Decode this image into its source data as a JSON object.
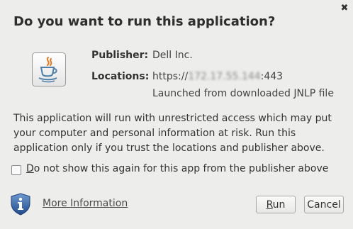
{
  "dialog": {
    "title": "Do you want to run this application?",
    "close_icon": "close-icon",
    "app_icon": "java-cup-icon",
    "publisher_label": "Publisher:",
    "publisher_value": "Dell Inc.",
    "locations_label": "Locations:",
    "location_prefix": "https://",
    "location_redacted": "172.17.55.144",
    "location_suffix": ":443",
    "launched_from": "Launched from downloaded JNLP file",
    "message": "This application will run with unrestricted access which may put your computer and personal information at risk. Run this application only if you trust the locations and publisher above.",
    "checkbox": {
      "checked": false,
      "label_mnemonic": "D",
      "label_rest": "o not show this again for this app from the publisher above"
    },
    "info_icon": "shield-info-icon",
    "more_info_link": "More Information",
    "run_button": {
      "mnemonic": "R",
      "rest": "un"
    },
    "cancel_button": "Cancel"
  }
}
